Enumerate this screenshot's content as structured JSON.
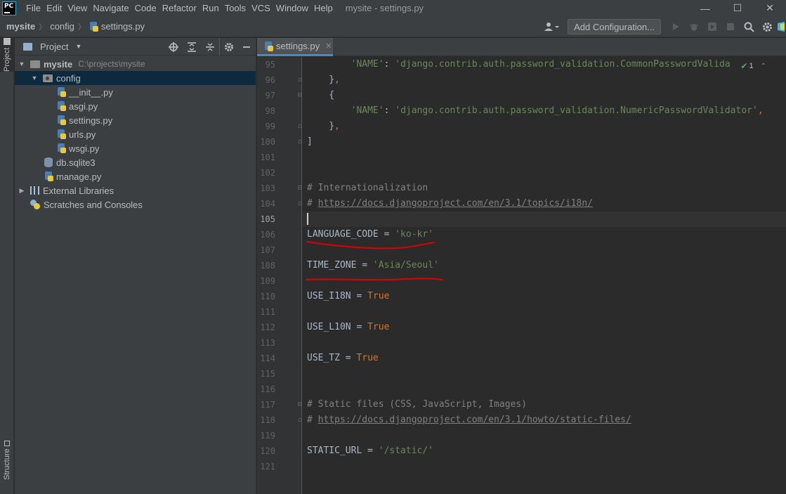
{
  "app": {
    "logo_text": "PC",
    "window_title": "mysite - settings.py",
    "menu": [
      "File",
      "Edit",
      "View",
      "Navigate",
      "Code",
      "Refactor",
      "Run",
      "Tools",
      "VCS",
      "Window",
      "Help"
    ],
    "window_controls": {
      "minimize": "—",
      "maximize": "☐",
      "close": "✕"
    }
  },
  "navbar": {
    "crumbs": [
      "mysite",
      "config",
      "settings.py"
    ],
    "add_configuration_label": "Add Configuration...",
    "icons": [
      "user-icon",
      "run-icon",
      "debug-icon",
      "coverage-icon",
      "stop-icon",
      "search-icon",
      "settings-icon",
      "plugin-icon"
    ]
  },
  "left_strip": {
    "project_tab": "Project",
    "structure_tab": "Structure"
  },
  "project_panel": {
    "title": "Project",
    "tree": [
      {
        "name": "mysite",
        "path": "C:\\projects\\mysite",
        "level": 0,
        "kind": "folder",
        "expanded": true
      },
      {
        "name": "config",
        "level": 1,
        "kind": "package",
        "expanded": true,
        "selected": true
      },
      {
        "name": "__init__.py",
        "level": 2,
        "kind": "py"
      },
      {
        "name": "asgi.py",
        "level": 2,
        "kind": "py"
      },
      {
        "name": "settings.py",
        "level": 2,
        "kind": "py"
      },
      {
        "name": "urls.py",
        "level": 2,
        "kind": "py"
      },
      {
        "name": "wsgi.py",
        "level": 2,
        "kind": "py"
      },
      {
        "name": "db.sqlite3",
        "level": 1,
        "kind": "db"
      },
      {
        "name": "manage.py",
        "level": 1,
        "kind": "py"
      },
      {
        "name": "External Libraries",
        "level": 0,
        "kind": "lib",
        "expanded": false
      },
      {
        "name": "Scratches and Consoles",
        "level": 0,
        "kind": "scratch"
      }
    ]
  },
  "editor": {
    "tab_label": "settings.py",
    "inspection": {
      "count": "1"
    },
    "current_line": 105,
    "lines": [
      {
        "no": 95,
        "text": "        'NAME': 'django.contrib.auth.password_validation.CommonPasswordValida"
      },
      {
        "no": 96,
        "text": "    },"
      },
      {
        "no": 97,
        "text": "    {"
      },
      {
        "no": 98,
        "text": "        'NAME': 'django.contrib.auth.password_validation.NumericPasswordValidator',"
      },
      {
        "no": 99,
        "text": "    },"
      },
      {
        "no": 100,
        "text": "]"
      },
      {
        "no": 101,
        "text": ""
      },
      {
        "no": 102,
        "text": ""
      },
      {
        "no": 103,
        "text": "# Internationalization"
      },
      {
        "no": 104,
        "text": "# https://docs.djangoproject.com/en/3.1/topics/i18n/"
      },
      {
        "no": 105,
        "text": ""
      },
      {
        "no": 106,
        "text": "LANGUAGE_CODE = 'ko-kr'"
      },
      {
        "no": 107,
        "text": ""
      },
      {
        "no": 108,
        "text": "TIME_ZONE = 'Asia/Seoul'"
      },
      {
        "no": 109,
        "text": ""
      },
      {
        "no": 110,
        "text": "USE_I18N = True"
      },
      {
        "no": 111,
        "text": ""
      },
      {
        "no": 112,
        "text": "USE_L10N = True"
      },
      {
        "no": 113,
        "text": ""
      },
      {
        "no": 114,
        "text": "USE_TZ = True"
      },
      {
        "no": 115,
        "text": ""
      },
      {
        "no": 116,
        "text": ""
      },
      {
        "no": 117,
        "text": "# Static files (CSS, JavaScript, Images)"
      },
      {
        "no": 118,
        "text": "# https://docs.djangoproject.com/en/3.1/howto/static-files/"
      },
      {
        "no": 119,
        "text": ""
      },
      {
        "no": 120,
        "text": "STATIC_URL = '/static/'"
      },
      {
        "no": 121,
        "text": ""
      }
    ]
  },
  "colors": {
    "background": "#2b2b2b",
    "panel": "#3c3f41",
    "string": "#6a8759",
    "keyword": "#cc7832",
    "comment": "#808080",
    "annotation_red": "#e00000"
  }
}
